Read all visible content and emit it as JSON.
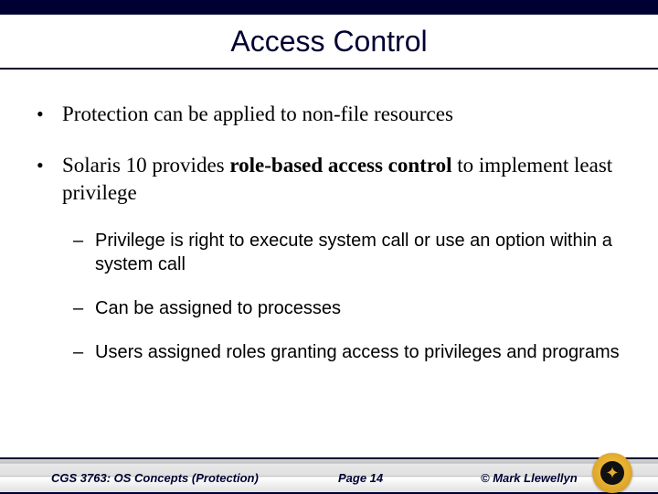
{
  "title": "Access Control",
  "bullets": {
    "b1": "Protection can be applied to non-file resources",
    "b2_pre": "Solaris 10 provides ",
    "b2_bold": "role-based access control",
    "b2_post": " to implement least privilege",
    "sub1": "Privilege is right to execute system call or use an option within a system call",
    "sub2": "Can be assigned to processes",
    "sub3": "Users assigned roles granting access to privileges and programs"
  },
  "footer": {
    "left": "CGS 3763: OS Concepts (Protection)",
    "center": "Page 14",
    "right": "© Mark Llewellyn"
  }
}
